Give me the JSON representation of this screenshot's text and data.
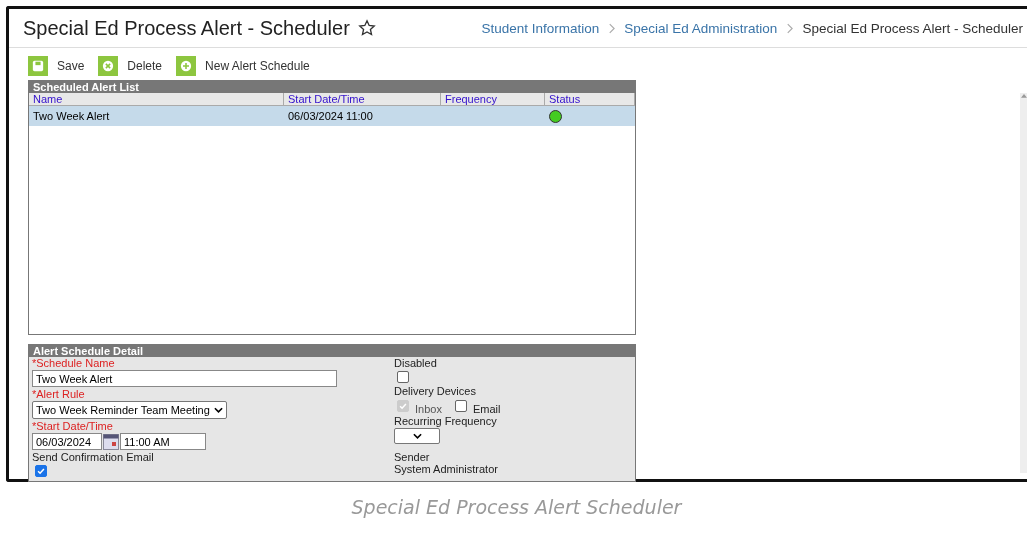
{
  "page": {
    "title": "Special Ed Process Alert - Scheduler",
    "breadcrumbs": [
      {
        "label": "Student Information",
        "kind": "link"
      },
      {
        "label": "Special Ed Administration",
        "kind": "link"
      },
      {
        "label": "Special Ed Process Alert - Scheduler",
        "kind": "current"
      }
    ]
  },
  "toolbar": [
    {
      "label": "Save",
      "kind": "save"
    },
    {
      "label": "Delete",
      "kind": "delete"
    },
    {
      "label": "New Alert Schedule",
      "kind": "new"
    }
  ],
  "alert_list": {
    "title": "Scheduled Alert List",
    "columns": [
      "Name",
      "Start Date/Time",
      "Frequency",
      "Status"
    ],
    "rows": [
      {
        "name": "Two Week Alert",
        "start": "06/03/2024 11:00",
        "selected": true,
        "color": "#44cc22"
      }
    ]
  },
  "detail": {
    "title": "Alert Schedule Detail",
    "schedule_name": {
      "label": "*Schedule Name",
      "value": "Two Week Alert"
    },
    "alert_rule": {
      "label": "*Alert Rule",
      "value": "Two Week Reminder Team Meeting"
    },
    "start": {
      "label": "*Start Date/Time",
      "date": "06/03/2024",
      "time": "11:00 AM"
    },
    "confirmation": {
      "label": "Send Confirmation Email",
      "checked": true
    },
    "disabled": {
      "label": "Disabled",
      "checked": false
    },
    "delivery": {
      "label": "Delivery Devices",
      "options": [
        {
          "label": "Inbox",
          "checked": true,
          "disabled": true
        },
        {
          "label": "Email",
          "checked": false,
          "disabled": false
        }
      ]
    },
    "recurring": {
      "label": "Recurring Frequency"
    },
    "sender": {
      "label": "Sender",
      "value": "System Administrator"
    }
  },
  "caption": "Special Ed Process Alert Scheduler"
}
